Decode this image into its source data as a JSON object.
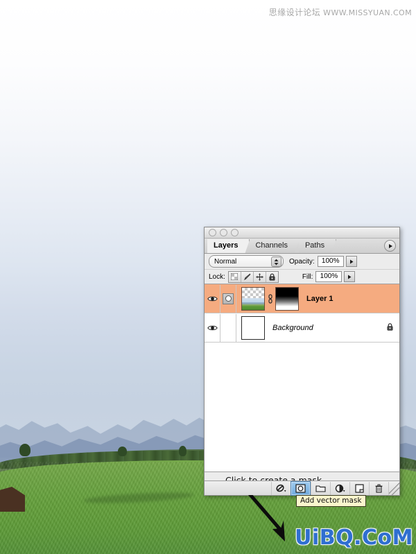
{
  "watermarks": {
    "top_cn": "思缘设计论坛",
    "top_url": "WWW.MISSYUAN.COM",
    "bottom": "UiBQ.CoM"
  },
  "palette": {
    "window_controls": [
      "close",
      "minimize",
      "zoom"
    ],
    "tabs": [
      {
        "label": "Layers",
        "active": true
      },
      {
        "label": "Channels",
        "active": false
      },
      {
        "label": "Paths",
        "active": false
      }
    ],
    "menu_icon": "panel-menu-triangle-icon",
    "blend": {
      "mode": "Normal",
      "opacity_label": "Opacity:",
      "opacity_value": "100%"
    },
    "lock": {
      "label": "Lock:",
      "buttons": [
        {
          "name": "lock-transparent-pixels",
          "icon": "checkerboard-icon"
        },
        {
          "name": "lock-image-pixels",
          "icon": "brush-icon"
        },
        {
          "name": "lock-position",
          "icon": "move-arrows-icon"
        },
        {
          "name": "lock-all",
          "icon": "padlock-icon"
        }
      ],
      "fill_label": "Fill:",
      "fill_value": "100%"
    },
    "layers": [
      {
        "name": "Layer 1",
        "visible": true,
        "selected": true,
        "has_mask": true,
        "mask_linked": true,
        "locked": false,
        "thumbnail": "landscape-with-transparency",
        "mask_thumbnail": "black-to-white-gradient"
      },
      {
        "name": "Background",
        "visible": true,
        "selected": false,
        "has_mask": false,
        "mask_linked": false,
        "locked": true,
        "thumbnail": "white-canvas",
        "mask_thumbnail": ""
      }
    ],
    "annotation": {
      "text": "Click to create a mask",
      "arrow": "diagonal-arrow-down-right"
    },
    "toolbar": [
      {
        "name": "link-layers-button",
        "icon": "chain-link-icon",
        "active": false
      },
      {
        "name": "add-layer-mask-button",
        "icon": "add-mask-icon",
        "active": true
      },
      {
        "name": "new-group-button",
        "icon": "folder-icon",
        "active": false
      },
      {
        "name": "new-adjustment-layer-button",
        "icon": "half-circle-icon",
        "active": false
      },
      {
        "name": "new-layer-button",
        "icon": "new-page-icon",
        "active": false
      },
      {
        "name": "delete-layer-button",
        "icon": "trash-icon",
        "active": false
      }
    ],
    "tooltip": "Add vector mask"
  }
}
